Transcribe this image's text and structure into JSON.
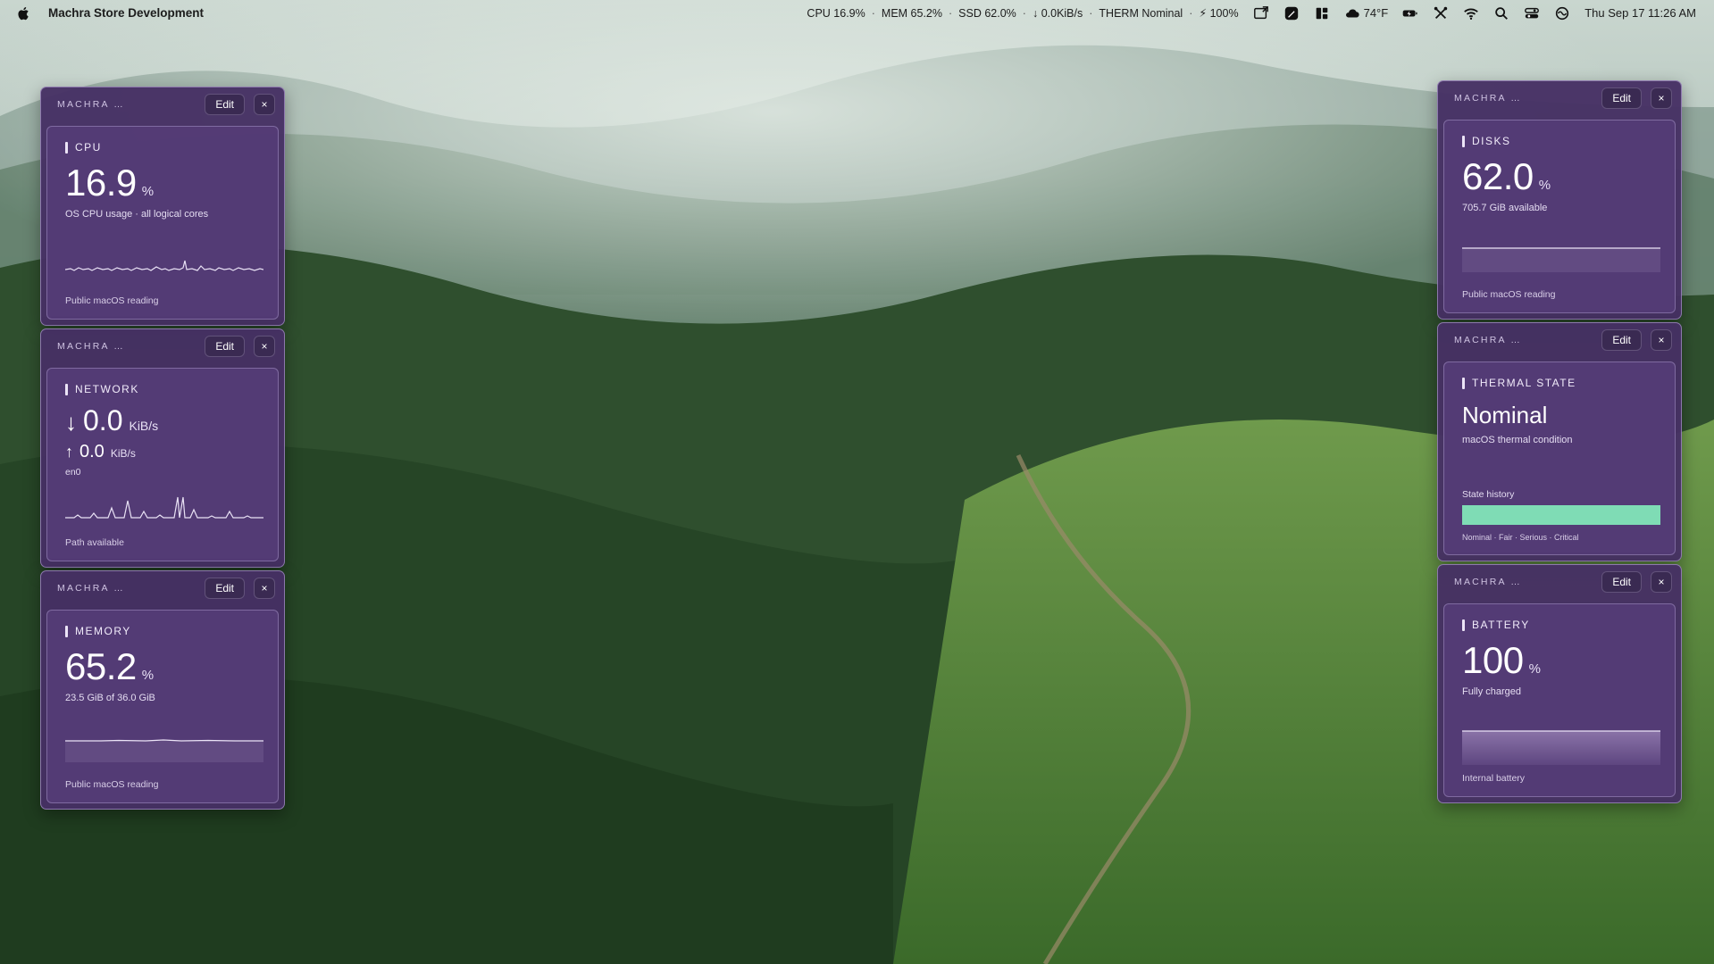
{
  "menubar": {
    "app_name": "Machra Store Development",
    "stats": [
      "CPU 16.9%",
      "MEM 65.2%",
      "SSD 62.0%",
      "↓ 0.0KiB/s",
      "THERM Nominal",
      "⚡ 100%"
    ],
    "separator": "·",
    "weather": "74°F",
    "clock": "Thu Sep 17  11:26 AM",
    "icons": [
      "apple-icon",
      "screen-share-icon",
      "pen-app-icon",
      "grid-app-icon",
      "cloud-icon",
      "battery-charging-icon",
      "tools-icon",
      "wifi-icon",
      "search-icon",
      "control-center-icon",
      "siri-icon"
    ]
  },
  "widgets": {
    "header_title": "MACHRA STORE DEVE...",
    "edit_label": "Edit",
    "close_label": "×",
    "cpu": {
      "label": "CPU",
      "value": "16.9",
      "unit": "%",
      "subtext": "OS CPU usage · all logical cores",
      "footnote": "Public macOS reading"
    },
    "network": {
      "label": "NETWORK",
      "down_arrow": "↓",
      "down_value": "0.0",
      "down_unit": "KiB/s",
      "up_arrow": "↑",
      "up_value": "0.0",
      "up_unit": "KiB/s",
      "interface": "en0",
      "footnote": "Path available"
    },
    "memory": {
      "label": "MEMORY",
      "value": "65.2",
      "unit": "%",
      "subtext": "23.5 GiB of 36.0 GiB",
      "footnote": "Public macOS reading"
    },
    "disks": {
      "label": "DISKS",
      "value": "62.0",
      "unit": "%",
      "subtext": "705.7 GiB available",
      "footnote": "Public macOS reading"
    },
    "thermal": {
      "label": "THERMAL STATE",
      "state": "Nominal",
      "subtext": "macOS thermal condition",
      "history_label": "State history",
      "legend": "Nominal · Fair · Serious · Critical",
      "state_color": "#7fdcb5"
    },
    "battery": {
      "label": "BATTERY",
      "value": "100",
      "unit": "%",
      "subtext": "Fully charged",
      "footnote": "Internal battery"
    }
  },
  "colors": {
    "widget_bg": "#463064",
    "card_bg": "#543c76",
    "accent_mint": "#7fdcb5"
  }
}
